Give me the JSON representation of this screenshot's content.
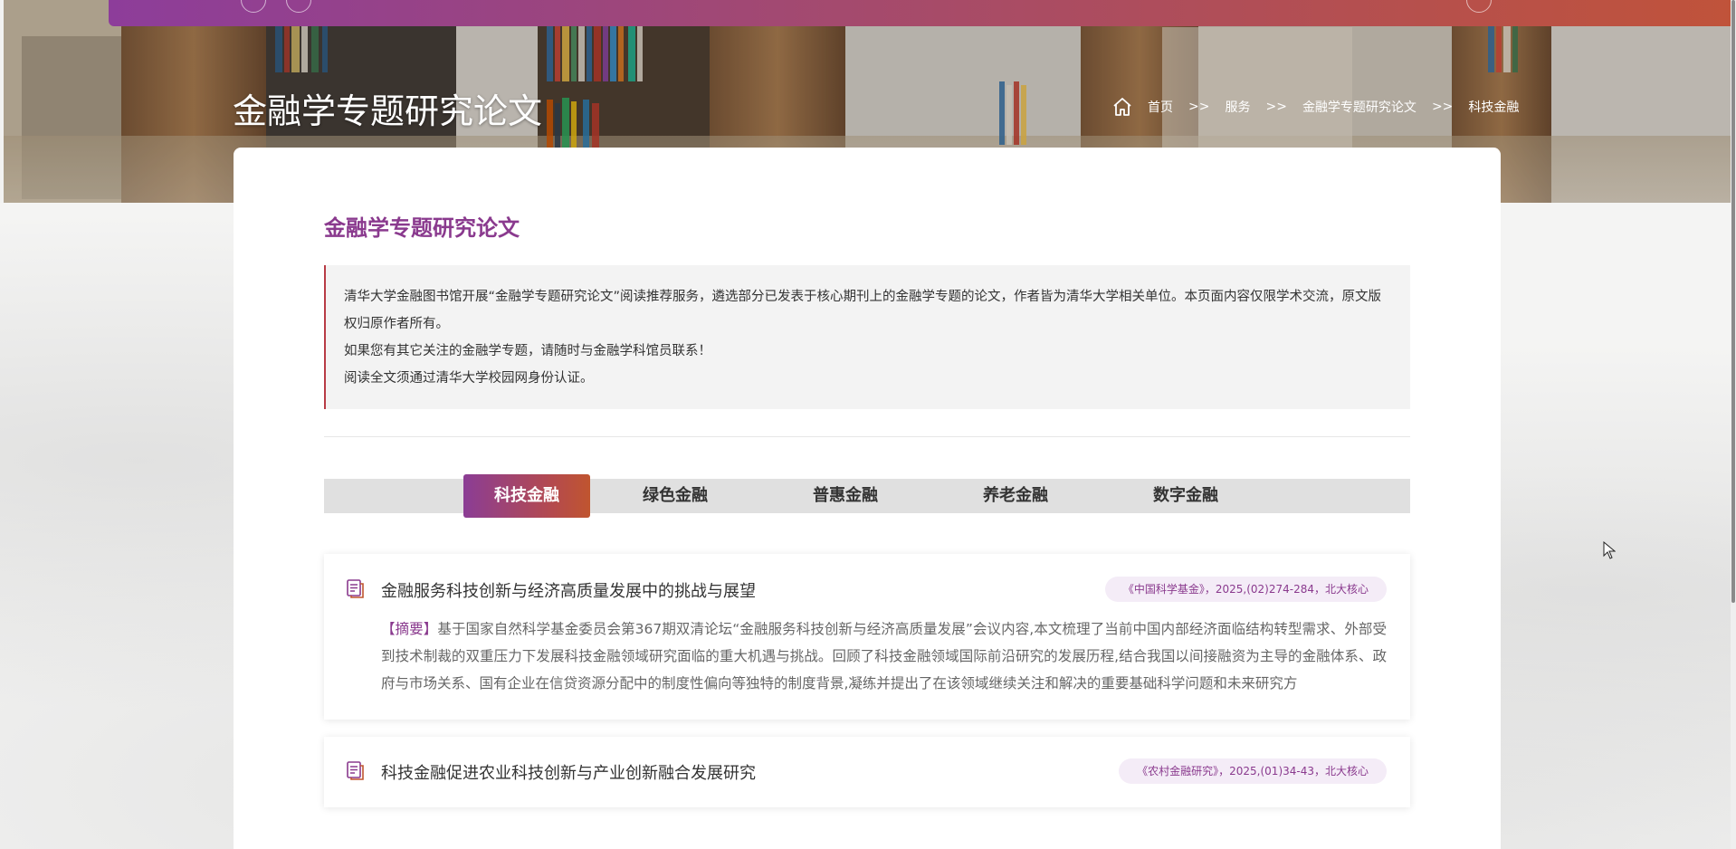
{
  "header": {
    "page_title": "金融学专题研究论文",
    "breadcrumb": [
      {
        "label": "首页"
      },
      {
        "label": "服务"
      },
      {
        "label": "金融学专题研究论文"
      },
      {
        "label": "科技金融"
      }
    ],
    "breadcrumb_separator": ">>",
    "home_icon": "home-icon"
  },
  "main": {
    "section_title": "金融学专题研究论文",
    "notice": {
      "lines": [
        "清华大学金融图书馆开展“金融学专题研究论文”阅读推荐服务，遴选部分已发表于核心期刊上的金融学专题的论文，作者皆为清华大学相关单位。本页面内容仅限学术交流，原文版权归原作者所有。",
        "如果您有其它关注的金融学专题，请随时与金融学科馆员联系！",
        "阅读全文须通过清华大学校园网身份认证。"
      ]
    },
    "tabs": [
      {
        "label": "科技金融",
        "active": true
      },
      {
        "label": "绿色金融",
        "active": false
      },
      {
        "label": "普惠金融",
        "active": false
      },
      {
        "label": "养老金融",
        "active": false
      },
      {
        "label": "数字金融",
        "active": false
      }
    ],
    "articles": [
      {
        "title": "金融服务科技创新与经济高质量发展中的挑战与展望",
        "source": "《中国科学基金》，2025,(02)274-284，北大核心",
        "abstract_label": "【摘要】",
        "abstract": "基于国家自然科学基金委员会第367期双清论坛“金融服务科技创新与经济高质量发展”会议内容,本文梳理了当前中国内部经济面临结构转型需求、外部受到技术制裁的双重压力下发展科技金融领域研究面临的重大机遇与挑战。回顾了科技金融领域国际前沿研究的发展历程,结合我国以间接融资为主导的金融体系、政府与市场关系、国有企业在信贷资源分配中的制度性偏向等独特的制度背景,凝练并提出了在该领域继续关注和解决的重要基础科学问题和未来研究方"
      },
      {
        "title": "科技金融促进农业科技创新与产业创新融合发展研究",
        "source": "《农村金融研究》，2025,(01)34-43，北大核心"
      }
    ]
  },
  "colors": {
    "accent_purple": "#8a3a8e",
    "accent_orange": "#c0552f",
    "notice_border": "#b83b45"
  }
}
